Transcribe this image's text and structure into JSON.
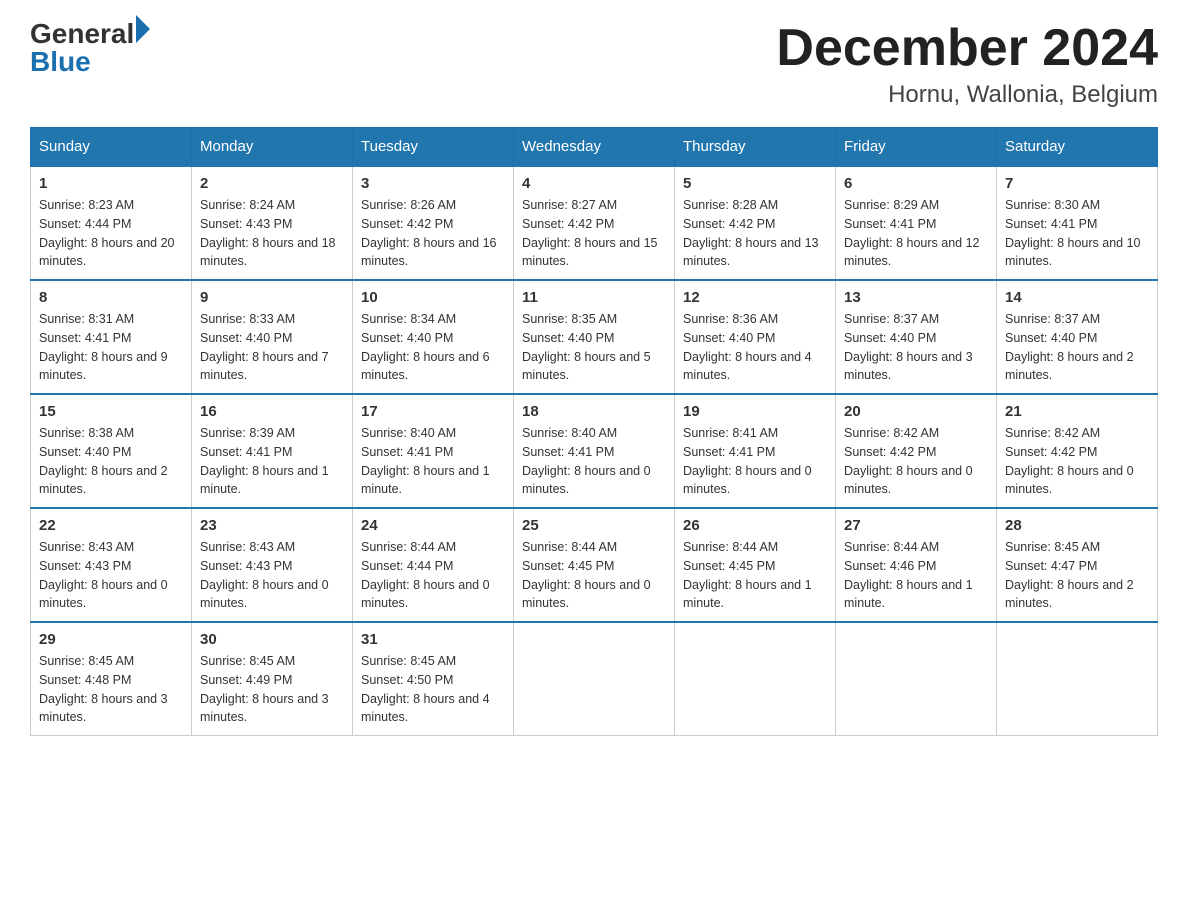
{
  "header": {
    "logo": {
      "general": "General",
      "blue": "Blue"
    },
    "title": "December 2024",
    "subtitle": "Hornu, Wallonia, Belgium"
  },
  "days_of_week": [
    "Sunday",
    "Monday",
    "Tuesday",
    "Wednesday",
    "Thursday",
    "Friday",
    "Saturday"
  ],
  "weeks": [
    [
      {
        "day": "1",
        "sunrise": "8:23 AM",
        "sunset": "4:44 PM",
        "daylight": "8 hours and 20 minutes."
      },
      {
        "day": "2",
        "sunrise": "8:24 AM",
        "sunset": "4:43 PM",
        "daylight": "8 hours and 18 minutes."
      },
      {
        "day": "3",
        "sunrise": "8:26 AM",
        "sunset": "4:42 PM",
        "daylight": "8 hours and 16 minutes."
      },
      {
        "day": "4",
        "sunrise": "8:27 AM",
        "sunset": "4:42 PM",
        "daylight": "8 hours and 15 minutes."
      },
      {
        "day": "5",
        "sunrise": "8:28 AM",
        "sunset": "4:42 PM",
        "daylight": "8 hours and 13 minutes."
      },
      {
        "day": "6",
        "sunrise": "8:29 AM",
        "sunset": "4:41 PM",
        "daylight": "8 hours and 12 minutes."
      },
      {
        "day": "7",
        "sunrise": "8:30 AM",
        "sunset": "4:41 PM",
        "daylight": "8 hours and 10 minutes."
      }
    ],
    [
      {
        "day": "8",
        "sunrise": "8:31 AM",
        "sunset": "4:41 PM",
        "daylight": "8 hours and 9 minutes."
      },
      {
        "day": "9",
        "sunrise": "8:33 AM",
        "sunset": "4:40 PM",
        "daylight": "8 hours and 7 minutes."
      },
      {
        "day": "10",
        "sunrise": "8:34 AM",
        "sunset": "4:40 PM",
        "daylight": "8 hours and 6 minutes."
      },
      {
        "day": "11",
        "sunrise": "8:35 AM",
        "sunset": "4:40 PM",
        "daylight": "8 hours and 5 minutes."
      },
      {
        "day": "12",
        "sunrise": "8:36 AM",
        "sunset": "4:40 PM",
        "daylight": "8 hours and 4 minutes."
      },
      {
        "day": "13",
        "sunrise": "8:37 AM",
        "sunset": "4:40 PM",
        "daylight": "8 hours and 3 minutes."
      },
      {
        "day": "14",
        "sunrise": "8:37 AM",
        "sunset": "4:40 PM",
        "daylight": "8 hours and 2 minutes."
      }
    ],
    [
      {
        "day": "15",
        "sunrise": "8:38 AM",
        "sunset": "4:40 PM",
        "daylight": "8 hours and 2 minutes."
      },
      {
        "day": "16",
        "sunrise": "8:39 AM",
        "sunset": "4:41 PM",
        "daylight": "8 hours and 1 minute."
      },
      {
        "day": "17",
        "sunrise": "8:40 AM",
        "sunset": "4:41 PM",
        "daylight": "8 hours and 1 minute."
      },
      {
        "day": "18",
        "sunrise": "8:40 AM",
        "sunset": "4:41 PM",
        "daylight": "8 hours and 0 minutes."
      },
      {
        "day": "19",
        "sunrise": "8:41 AM",
        "sunset": "4:41 PM",
        "daylight": "8 hours and 0 minutes."
      },
      {
        "day": "20",
        "sunrise": "8:42 AM",
        "sunset": "4:42 PM",
        "daylight": "8 hours and 0 minutes."
      },
      {
        "day": "21",
        "sunrise": "8:42 AM",
        "sunset": "4:42 PM",
        "daylight": "8 hours and 0 minutes."
      }
    ],
    [
      {
        "day": "22",
        "sunrise": "8:43 AM",
        "sunset": "4:43 PM",
        "daylight": "8 hours and 0 minutes."
      },
      {
        "day": "23",
        "sunrise": "8:43 AM",
        "sunset": "4:43 PM",
        "daylight": "8 hours and 0 minutes."
      },
      {
        "day": "24",
        "sunrise": "8:44 AM",
        "sunset": "4:44 PM",
        "daylight": "8 hours and 0 minutes."
      },
      {
        "day": "25",
        "sunrise": "8:44 AM",
        "sunset": "4:45 PM",
        "daylight": "8 hours and 0 minutes."
      },
      {
        "day": "26",
        "sunrise": "8:44 AM",
        "sunset": "4:45 PM",
        "daylight": "8 hours and 1 minute."
      },
      {
        "day": "27",
        "sunrise": "8:44 AM",
        "sunset": "4:46 PM",
        "daylight": "8 hours and 1 minute."
      },
      {
        "day": "28",
        "sunrise": "8:45 AM",
        "sunset": "4:47 PM",
        "daylight": "8 hours and 2 minutes."
      }
    ],
    [
      {
        "day": "29",
        "sunrise": "8:45 AM",
        "sunset": "4:48 PM",
        "daylight": "8 hours and 3 minutes."
      },
      {
        "day": "30",
        "sunrise": "8:45 AM",
        "sunset": "4:49 PM",
        "daylight": "8 hours and 3 minutes."
      },
      {
        "day": "31",
        "sunrise": "8:45 AM",
        "sunset": "4:50 PM",
        "daylight": "8 hours and 4 minutes."
      },
      null,
      null,
      null,
      null
    ]
  ]
}
